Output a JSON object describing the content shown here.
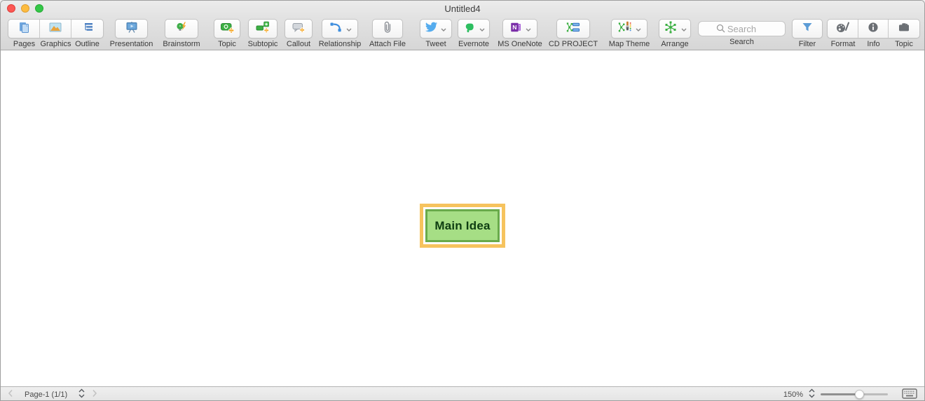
{
  "window": {
    "title": "Untitled4"
  },
  "titlebar_buttons": [
    "close",
    "minimize",
    "zoom"
  ],
  "toolbar": {
    "labels": {
      "pages": "Pages",
      "graphics": "Graphics",
      "outline": "Outline",
      "presentation": "Presentation",
      "brainstorm": "Brainstorm",
      "topic": "Topic",
      "subtopic": "Subtopic",
      "callout": "Callout",
      "relationship": "Relationship",
      "attach_file": "Attach File",
      "tweet": "Tweet",
      "evernote": "Evernote",
      "ms_onenote": "MS OneNote",
      "cd_project": "CD PROJECT",
      "map_theme": "Map Theme",
      "arrange": "Arrange",
      "search": "Search",
      "filter": "Filter",
      "format": "Format",
      "info": "Info",
      "topic_panel": "Topic"
    },
    "search_placeholder": "Search",
    "dropdown_buttons": [
      "relationship",
      "tweet",
      "evernote",
      "ms_onenote",
      "map_theme",
      "arrange"
    ]
  },
  "canvas": {
    "main_topic": "Main Idea",
    "topic_selected": true
  },
  "statusbar": {
    "page": "Page-1 (1/1)",
    "zoom": "150%",
    "slider_fraction": 0.58
  },
  "colors": {
    "topic_fill": "#A6DE85",
    "topic_border": "#69AA4B",
    "topic_text": "#0E3D11",
    "selection_frame": "#F6C35E",
    "traffic_red": "#FC5753",
    "traffic_yellow": "#FDBC40",
    "traffic_green": "#33C748",
    "accent_green": "#3CB043",
    "accent_blue": "#4A90D9",
    "accent_orange": "#F5A623"
  },
  "icons": [
    "pages-icon",
    "graphics-icon",
    "outline-icon",
    "presentation-icon",
    "brainstorm-icon",
    "topic-add-icon",
    "subtopic-add-icon",
    "callout-add-icon",
    "relationship-icon",
    "paperclip-icon",
    "twitter-bird-icon",
    "evernote-elephant-icon",
    "onenote-icon",
    "cd-project-icon",
    "map-theme-brush-icon",
    "arrange-radial-icon",
    "magnifier-icon",
    "filter-funnel-icon",
    "palette-pen-icon",
    "info-circle-icon",
    "topic-panel-icon",
    "chevron-down-icon",
    "page-stepper-icon",
    "zoom-stepper-icon",
    "keyboard-icon",
    "prev-page-icon",
    "next-page-icon"
  ]
}
